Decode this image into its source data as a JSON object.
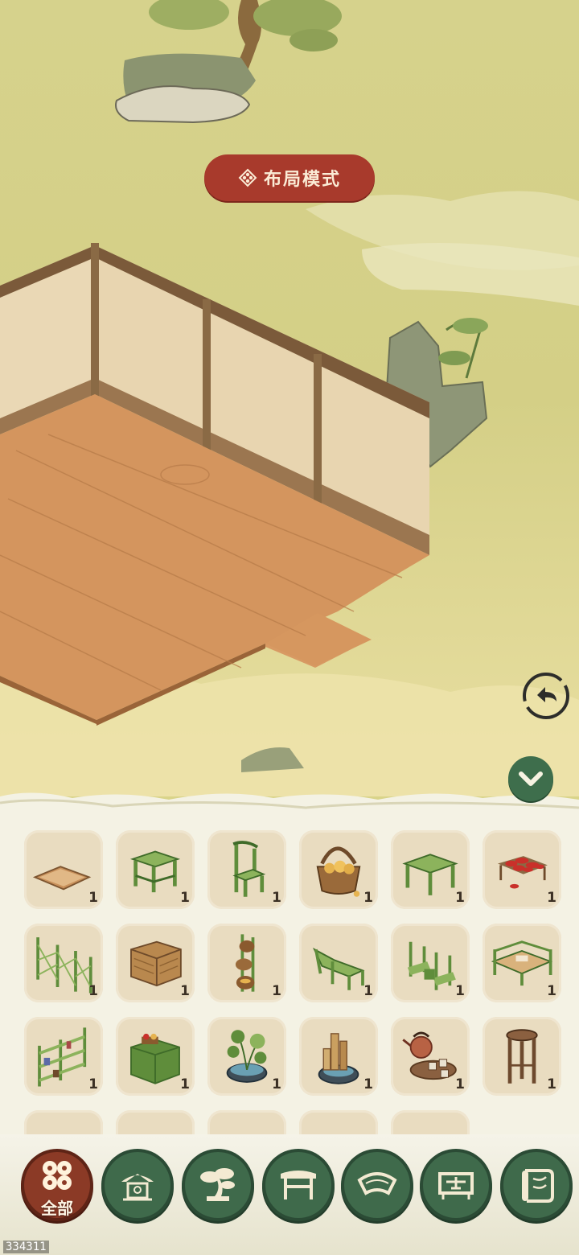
{
  "header": {
    "mode_label": "布局模式"
  },
  "controls": {
    "undo_icon": "undo-icon",
    "collapse_icon": "chevron-down-icon"
  },
  "inventory": {
    "items": [
      {
        "icon": "floor-mat-icon",
        "qty": "1"
      },
      {
        "icon": "bamboo-table-icon",
        "qty": "1"
      },
      {
        "icon": "bamboo-chair-icon",
        "qty": "1"
      },
      {
        "icon": "potato-basket-icon",
        "qty": "1"
      },
      {
        "icon": "bamboo-square-table-icon",
        "qty": "1"
      },
      {
        "icon": "chili-rack-icon",
        "qty": "1"
      },
      {
        "icon": "bamboo-fence-screen-icon",
        "qty": "1"
      },
      {
        "icon": "wicker-trunk-icon",
        "qty": "1"
      },
      {
        "icon": "basket-stand-icon",
        "qty": "1"
      },
      {
        "icon": "bamboo-lounge-chair-icon",
        "qty": "1"
      },
      {
        "icon": "bamboo-chair-set-icon",
        "qty": "1"
      },
      {
        "icon": "bamboo-bed-icon",
        "qty": "1"
      },
      {
        "icon": "bamboo-bookshelf-icon",
        "qty": "1"
      },
      {
        "icon": "bamboo-cabinet-icon",
        "qty": "1"
      },
      {
        "icon": "lotus-pot-icon",
        "qty": "1"
      },
      {
        "icon": "bamboo-fountain-icon",
        "qty": "1"
      },
      {
        "icon": "teapot-set-icon",
        "qty": "1"
      },
      {
        "icon": "wooden-stool-icon",
        "qty": "1"
      }
    ]
  },
  "tabs": [
    {
      "icon": "all-grid-icon",
      "label": "全部",
      "active": true
    },
    {
      "icon": "pavilion-icon",
      "label": ""
    },
    {
      "icon": "bonsai-tree-icon",
      "label": ""
    },
    {
      "icon": "table-icon",
      "label": ""
    },
    {
      "icon": "fan-icon",
      "label": ""
    },
    {
      "icon": "screen-icon",
      "label": ""
    },
    {
      "icon": "scroll-icon",
      "label": ""
    }
  ],
  "watermark": "334311",
  "colors": {
    "accent_red": "#a83a2c",
    "tab_green": "#3f6a4b",
    "cell_bg": "#e9dcc0",
    "meadow": "#d9d48a"
  }
}
